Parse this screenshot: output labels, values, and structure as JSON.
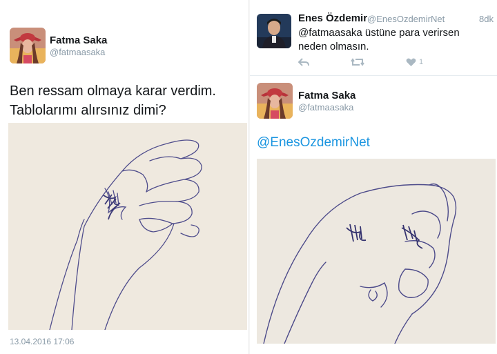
{
  "left_tweet": {
    "name": "Fatma Saka",
    "handle": "@fatmaasaka",
    "text_line1": "Ben ressam olmaya karar verdim.",
    "text_line2": "Tablolarımı alırsınız dimi?",
    "date": "13.04.2016 17:06"
  },
  "reply_tweet": {
    "name": "Enes Özdemir",
    "handle": "@EnesOzdemirNet",
    "time": "8dk",
    "text_line1": "@fatmaasaka üstüne para verirsen",
    "text_line2": "neden olmasın.",
    "like_count": "1"
  },
  "answer_tweet": {
    "name": "Fatma Saka",
    "handle": "@fatmaasaka",
    "mention": "@EnesOzdemirNet"
  },
  "colors": {
    "link": "#1b95e0",
    "text": "#14171a",
    "muted": "#8899a6",
    "paper": "#efe9df",
    "ink": "#4a4a8a"
  }
}
